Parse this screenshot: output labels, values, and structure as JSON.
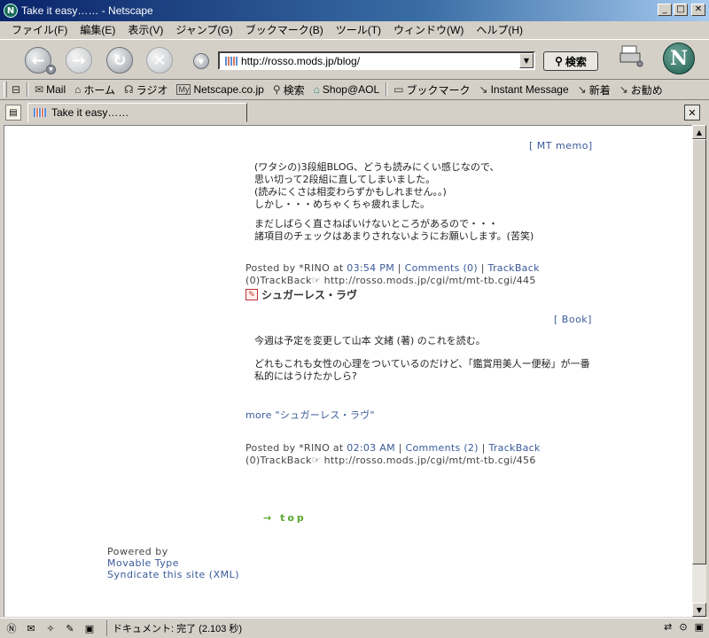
{
  "window": {
    "title": "Take it easy…… - Netscape"
  },
  "menu": [
    "ファイル(F)",
    "編集(E)",
    "表示(V)",
    "ジャンプ(G)",
    "ブックマーク(B)",
    "ツール(T)",
    "ウィンドウ(W)",
    "ヘルプ(H)"
  ],
  "nav": {
    "url": "http://rosso.mods.jp/blog/",
    "search_label": "検索"
  },
  "personal_toolbar": [
    {
      "icon": "mail-icon",
      "glyph": "✉",
      "label": "Mail"
    },
    {
      "icon": "home-icon",
      "glyph": "⌂",
      "label": "ホーム"
    },
    {
      "icon": "radio-icon",
      "glyph": "☊",
      "label": "ラジオ"
    },
    {
      "icon": "my-icon",
      "glyph": "My",
      "label": "Netscape.co.jp"
    },
    {
      "icon": "search-icon",
      "glyph": "⚲",
      "label": "検索"
    },
    {
      "icon": "shop-icon",
      "glyph": "⌂",
      "label": "Shop@AOL"
    },
    {
      "icon": "bookmark-folder-icon",
      "glyph": "▭",
      "label": "ブックマーク"
    },
    {
      "icon": "link-icon",
      "glyph": "↘",
      "label": "Instant Message"
    },
    {
      "icon": "link-icon",
      "glyph": "↘",
      "label": "新着"
    },
    {
      "icon": "link-icon",
      "glyph": "↘",
      "label": "お勧め"
    }
  ],
  "tab": {
    "title": "Take it easy……"
  },
  "content": {
    "post1": {
      "category": "[ MT memo]",
      "body": [
        "(ワタシの)3段組BLOG、どうも読みにくい感じなので、",
        "思い切って2段組に直してしまいました。",
        "(読みにくさは相変わらずかもしれません。。)",
        "しかし・・・めちゃくちゃ疲れました。",
        "",
        "まだしばらく直さねばいけないところがあるので・・・",
        "諸項目のチェックはあまりされないようにお願いします。(苦笑)"
      ],
      "posted_prefix": "Posted by *RINO at ",
      "time": "03:54 PM",
      "comments": "Comments (0)",
      "trackback": "TrackBack",
      "tb_line": "(0)TrackBack☞ http://rosso.mods.jp/cgi/mt/mt-tb.cgi/445"
    },
    "post2": {
      "title": "シュガーレス・ラヴ",
      "category": "[ Book]",
      "body1": "今週は予定を変更して山本 文緒 (著) のこれを読む。",
      "body2": [
        "どれもこれも女性の心理をついているのだけど、「鑑賞用美人ー便秘」が一番",
        "私的にはうけたかしら?"
      ],
      "more": "more \"シュガーレス・ラヴ\"",
      "posted_prefix": "Posted by *RINO at ",
      "time": "02:03 AM",
      "comments": "Comments (2)",
      "trackback": "TrackBack",
      "tb_line": "(0)TrackBack☞ http://rosso.mods.jp/cgi/mt/mt-tb.cgi/456"
    },
    "top_link": "top",
    "powered": {
      "label": "Powered by",
      "mt": "Movable Type",
      "syndicate": "Syndicate this site (XML)"
    }
  },
  "status": {
    "text": "ドキュメント: 完了 (2.103 秒)"
  }
}
